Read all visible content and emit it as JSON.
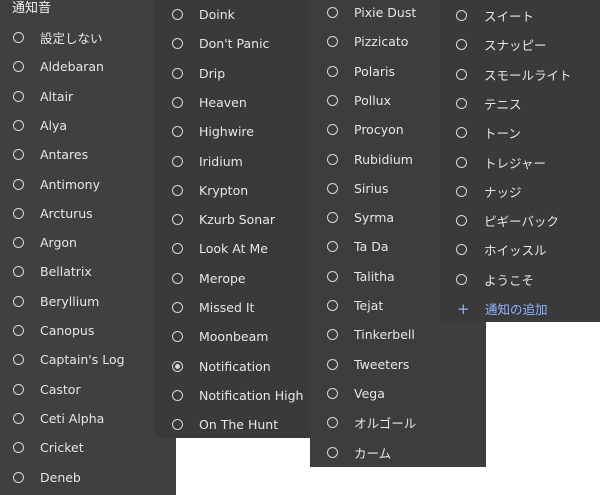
{
  "title": "通知音",
  "col1": [
    {
      "label": "設定しない",
      "selected": false
    },
    {
      "label": "Aldebaran",
      "selected": false
    },
    {
      "label": "Altair",
      "selected": false
    },
    {
      "label": "Alya",
      "selected": false
    },
    {
      "label": "Antares",
      "selected": false
    },
    {
      "label": "Antimony",
      "selected": false
    },
    {
      "label": "Arcturus",
      "selected": false
    },
    {
      "label": "Argon",
      "selected": false
    },
    {
      "label": "Bellatrix",
      "selected": false
    },
    {
      "label": "Beryllium",
      "selected": false
    },
    {
      "label": "Canopus",
      "selected": false
    },
    {
      "label": "Captain's Log",
      "selected": false
    },
    {
      "label": "Castor",
      "selected": false
    },
    {
      "label": "Ceti Alpha",
      "selected": false
    },
    {
      "label": "Cricket",
      "selected": false
    },
    {
      "label": "Deneb",
      "selected": false
    }
  ],
  "col2": [
    {
      "label": "Doink",
      "selected": false
    },
    {
      "label": "Don't Panic",
      "selected": false
    },
    {
      "label": "Drip",
      "selected": false
    },
    {
      "label": "Heaven",
      "selected": false
    },
    {
      "label": "Highwire",
      "selected": false
    },
    {
      "label": "Iridium",
      "selected": false
    },
    {
      "label": "Krypton",
      "selected": false
    },
    {
      "label": "Kzurb Sonar",
      "selected": false
    },
    {
      "label": "Look At Me",
      "selected": false
    },
    {
      "label": "Merope",
      "selected": false
    },
    {
      "label": "Missed It",
      "selected": false
    },
    {
      "label": "Moonbeam",
      "selected": false
    },
    {
      "label": "Notification",
      "selected": true
    },
    {
      "label": "Notification High",
      "selected": false
    },
    {
      "label": "On The Hunt",
      "selected": false
    }
  ],
  "col3": [
    {
      "label": "Pixie Dust",
      "selected": false
    },
    {
      "label": "Pizzicato",
      "selected": false
    },
    {
      "label": "Polaris",
      "selected": false
    },
    {
      "label": "Pollux",
      "selected": false
    },
    {
      "label": "Procyon",
      "selected": false
    },
    {
      "label": "Rubidium",
      "selected": false
    },
    {
      "label": "Sirius",
      "selected": false
    },
    {
      "label": "Syrma",
      "selected": false
    },
    {
      "label": "Ta Da",
      "selected": false
    },
    {
      "label": "Talitha",
      "selected": false
    },
    {
      "label": "Tejat",
      "selected": false
    },
    {
      "label": "Tinkerbell",
      "selected": false
    },
    {
      "label": "Tweeters",
      "selected": false
    },
    {
      "label": "Vega",
      "selected": false
    },
    {
      "label": "オルゴール",
      "selected": false
    },
    {
      "label": "カーム",
      "selected": false
    }
  ],
  "col4": [
    {
      "label": "スイート",
      "selected": false
    },
    {
      "label": "スナッピー",
      "selected": false
    },
    {
      "label": "スモールライト",
      "selected": false
    },
    {
      "label": "テニス",
      "selected": false
    },
    {
      "label": "トーン",
      "selected": false
    },
    {
      "label": "トレジャー",
      "selected": false
    },
    {
      "label": "ナッジ",
      "selected": false
    },
    {
      "label": "ピギーバック",
      "selected": false
    },
    {
      "label": "ホイッスル",
      "selected": false
    },
    {
      "label": "ようこそ",
      "selected": false
    }
  ],
  "add_notification": {
    "icon": "+",
    "label": "通知の追加"
  },
  "colors": {
    "panel_bg": "#3c3c3c",
    "text": "#e6e6e6",
    "accent": "#8fb6ff"
  }
}
